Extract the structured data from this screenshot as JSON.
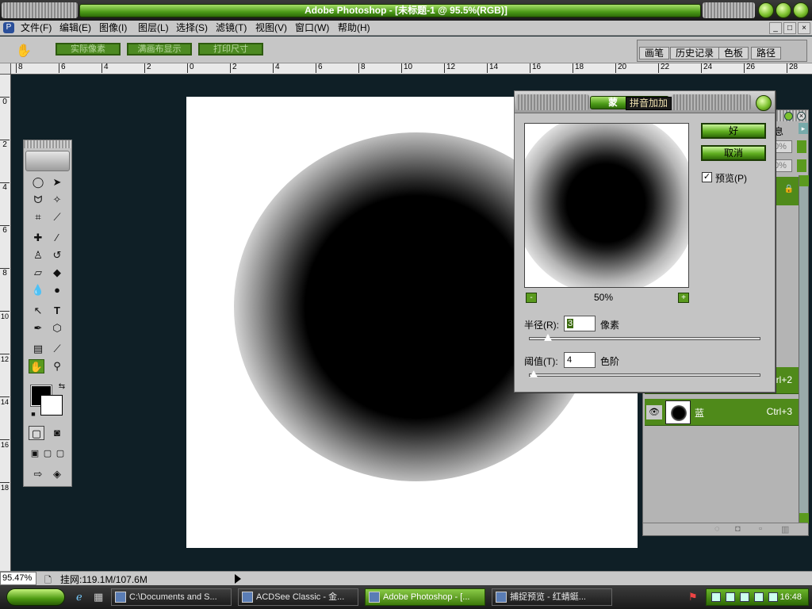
{
  "window": {
    "title": "Adobe Photoshop - [未标题-1 @ 95.5%(RGB)]"
  },
  "menu": {
    "items": [
      "文件(F)",
      "编辑(E)",
      "图像(I)",
      "图层(L)",
      "选择(S)",
      "滤镜(T)",
      "视图(V)",
      "窗口(W)",
      "帮助(H)"
    ],
    "mdi": [
      "_",
      "□",
      "×"
    ]
  },
  "options": {
    "buttons": [
      "实际像素",
      "满画布显示",
      "打印尺寸"
    ],
    "palette_tabs": [
      "画笔",
      "历史记录",
      "色板",
      "路径"
    ]
  },
  "rulers": {
    "h_ticks": [
      "8",
      "6",
      "4",
      "2",
      "0",
      "2",
      "4",
      "6",
      "8",
      "10",
      "12",
      "14",
      "16",
      "18",
      "20",
      "22",
      "24",
      "26",
      "28"
    ],
    "v_ticks": [
      "0",
      "2",
      "4",
      "6",
      "8",
      "10",
      "12",
      "14",
      "16",
      "18"
    ]
  },
  "dialog": {
    "title_fragment": "蒙",
    "ime_text": "拼音加加",
    "ok_label": "好",
    "cancel_label": "取消",
    "preview_label": "预览(P)",
    "preview_checked": true,
    "zoom_minus": "-",
    "zoom_plus": "+",
    "zoom_text": "50%",
    "radius_label": "半径(R):",
    "radius_value": "3",
    "radius_unit": "像素",
    "threshold_label": "阈值(T):",
    "threshold_value": "4",
    "threshold_unit": "色阶"
  },
  "layers": {
    "visible_fragments": [
      "息",
      "0%",
      "0%"
    ],
    "rows": [
      {
        "name": "",
        "shortcut": "rl+2"
      },
      {
        "name": "蓝",
        "shortcut": "Ctrl+3"
      }
    ]
  },
  "status": {
    "zoom": "95.47%",
    "doc_info": "挂网:119.1M/107.6M"
  },
  "taskbar": {
    "items": [
      {
        "label": "C:\\Documents and S...",
        "active": false
      },
      {
        "label": "ACDSee Classic - 金...",
        "active": false
      },
      {
        "label": "Adobe Photoshop - [...",
        "active": true
      },
      {
        "label": "捕捉预览 - 红蜻蜓...",
        "active": false
      }
    ],
    "clock": "16:48"
  }
}
